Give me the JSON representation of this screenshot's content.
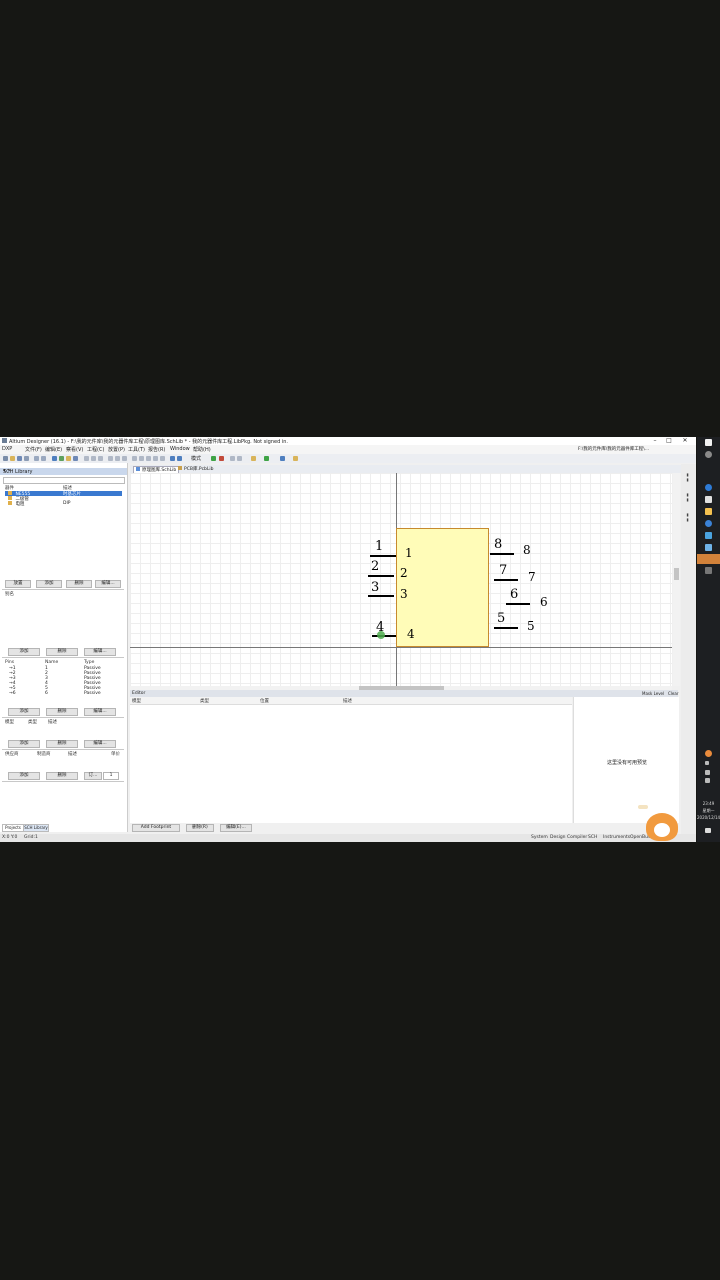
{
  "window": {
    "title": "Altium Designer (16.1) - F:\\我的元件库\\我的元器件库工程\\原理图库.SchLib * - 我的元器件库工程.LibPkg. Not signed in.",
    "buttons": [
      "–",
      "□",
      "✕"
    ]
  },
  "menu": {
    "items": [
      "DXP",
      "文件(F)",
      "编辑(E)",
      "察看(V)",
      "工程(C)",
      "放置(P)",
      "工具(T)",
      "报告(R)",
      "Window",
      "帮助(H)"
    ],
    "path": "F:\\我的元件库\\我的元器件库工程\\..."
  },
  "toolbar": {
    "mode_label": "模式"
  },
  "left_panel": {
    "title": "SCH Library",
    "controls": "▾ ✕",
    "components_header": [
      "器件",
      "描述"
    ],
    "components": [
      {
        "name": "NE555",
        "desc": "时基芯片"
      },
      {
        "name": "二极管",
        "desc": ""
      },
      {
        "name": "电阻",
        "desc": "DIP"
      }
    ],
    "comp_buttons": [
      "放置",
      "添加",
      "删除",
      "编辑..."
    ],
    "alias_label": "别名",
    "alias_buttons": [
      "添加",
      "删除",
      "编辑..."
    ],
    "pins_header": [
      "Pins",
      "Name",
      "Type"
    ],
    "pins": [
      {
        "pin": "1",
        "name": "1",
        "type": "Passive"
      },
      {
        "pin": "2",
        "name": "2",
        "type": "Passive"
      },
      {
        "pin": "3",
        "name": "3",
        "type": "Passive"
      },
      {
        "pin": "4",
        "name": "4",
        "type": "Passive"
      },
      {
        "pin": "5",
        "name": "5",
        "type": "Passive"
      },
      {
        "pin": "6",
        "name": "6",
        "type": "Passive"
      }
    ],
    "pin_buttons": [
      "添加",
      "删除",
      "编辑..."
    ],
    "model_header": [
      "模型",
      "类型",
      "描述"
    ],
    "model_buttons": [
      "添加",
      "删除",
      "编辑..."
    ],
    "supplier_header": [
      "供应商",
      "制造商",
      "描述",
      "单价"
    ],
    "supplier_buttons": [
      "添加",
      "删除",
      "订..."
    ],
    "supplier_qty": "1",
    "bottom_tabs": [
      "Projects",
      "SCH Library"
    ]
  },
  "doc_tabs": [
    "原理图库.SchLib",
    "PCB库.PcbLib"
  ],
  "schematic": {
    "left_pins": [
      {
        "outer": "1",
        "inner": "1"
      },
      {
        "outer": "2",
        "inner": "2"
      },
      {
        "outer": "3",
        "inner": "3"
      },
      {
        "outer": "4",
        "inner": "4"
      }
    ],
    "right_pins": [
      {
        "outer": "8",
        "inner": "8"
      },
      {
        "outer": "7",
        "inner": "7"
      },
      {
        "outer": "6",
        "inner": "6"
      },
      {
        "outer": "5",
        "inner": "5"
      }
    ]
  },
  "editor": {
    "label": "Editor",
    "columns": [
      "模型",
      "类型",
      "位置",
      "描述"
    ],
    "right_labels": [
      "Mask Level",
      "Clear"
    ],
    "preview_msg": "这里没有可用预览",
    "add_footprint": "Add Footprint",
    "remove_btn": "删除(R)",
    "edit_btn": "编辑(E)..."
  },
  "status": {
    "left": [
      "X:0 Y:0",
      "Grid:1"
    ],
    "right": [
      "System",
      "Design Compiler",
      "SCH",
      "Instruments",
      "OpenBus"
    ]
  },
  "taskbar": {
    "time": "23:49",
    "weekday": "星期一",
    "date": "2020/12/14"
  },
  "colors": {
    "component_fill": "#fffcb8",
    "component_border": "#c78a2e",
    "selection": "#3a79d0"
  }
}
